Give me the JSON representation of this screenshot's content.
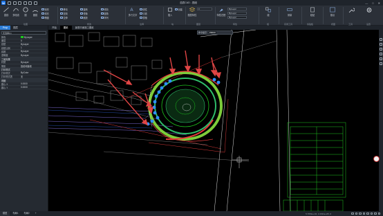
{
  "app": {
    "logo_letter": "W",
    "title": "浩辰CAD - 图纸"
  },
  "window": {
    "minimize": "—",
    "maximize": "□",
    "close": "✕"
  },
  "ribbon": {
    "draw": {
      "title": "绘图",
      "line": "直线",
      "polyline": "多段线",
      "circle": "圆",
      "arc": "圆弧",
      "rect": "矩形",
      "hatch": "填充",
      "spline": "样条曲线",
      "ellipse": "椭圆"
    },
    "modify": {
      "title": "修改",
      "move": "移动",
      "rotate": "旋转",
      "trim": "修剪",
      "copy": "复制",
      "mirror": "镜像",
      "fillet": "圆角",
      "stretch": "拉伸",
      "scale": "缩放",
      "array": "阵列"
    },
    "annotation": {
      "title": "注释",
      "text": "多行文字",
      "dim": "线性",
      "leader": "引线",
      "table": "表格"
    },
    "layers": {
      "title": "图层",
      "layer_props": "图层特性",
      "current_layer": "0"
    },
    "block": {
      "title": "块",
      "insert": "插入",
      "create": "创建"
    },
    "properties": {
      "title": "特性",
      "match": "特性匹配",
      "bylayer1": "ByLayer",
      "bylayer2": "ByLayer",
      "bylayer3": "ByLayer"
    },
    "groups": {
      "title": "组",
      "group": "组"
    },
    "utilities": {
      "title": "实用工具",
      "measure": "测量"
    },
    "clipboard": {
      "title": "剪贴板",
      "paste": "粘贴"
    },
    "view": {
      "title": "视图",
      "base": "基点"
    },
    "tools": {
      "title": "工具"
    },
    "settings": {
      "title": "设置"
    }
  },
  "left_panel": {
    "tabs": [
      "Prop",
      "图层"
    ],
    "selector": "无选择(1)",
    "rows": [
      {
        "k": "颜色",
        "v": "ByLayer",
        "swatch": true
      },
      {
        "k": "图层",
        "v": "0"
      },
      {
        "k": "线型",
        "v": "ByLayer"
      },
      {
        "k": "线型比例",
        "v": "1"
      },
      {
        "k": "线宽",
        "v": "ByLayer"
      },
      {
        "k": "透明度",
        "v": "ByLayer"
      }
    ],
    "section1": "三维效果",
    "rows2": [
      {
        "k": "材质",
        "v": "ByLayer"
      },
      {
        "k": "阴影",
        "v": "投射和接收"
      }
    ],
    "section2": "打印样式",
    "rows3": [
      {
        "k": "打印样式",
        "v": "ByColor"
      },
      {
        "k": "打印样式表",
        "v": "无"
      }
    ],
    "section3": "视图",
    "rows4": [
      {
        "k": "圆心 X",
        "v": "0.0000"
      },
      {
        "k": "圆心 Y",
        "v": "0.0000"
      }
    ]
  },
  "doc_tabs": [
    "开始",
    "图纸",
    "景观平面施工图纸"
  ],
  "command": {
    "label": "命令提示: ",
    "value": "PMNO"
  },
  "status": {
    "tabs": [
      "模型",
      "布局1",
      "布局2"
    ],
    "add": "+",
    "coords": "5.7652e+04, 1.0491e+05, 0"
  },
  "colors": {
    "accent": "#2f7fd9",
    "cad_green": "#1ec81e",
    "cad_red": "#e83a3a",
    "arrow_red": "#e04545",
    "marker_blue": "#2f8fff",
    "gray_lines": "#9a9a9a"
  }
}
